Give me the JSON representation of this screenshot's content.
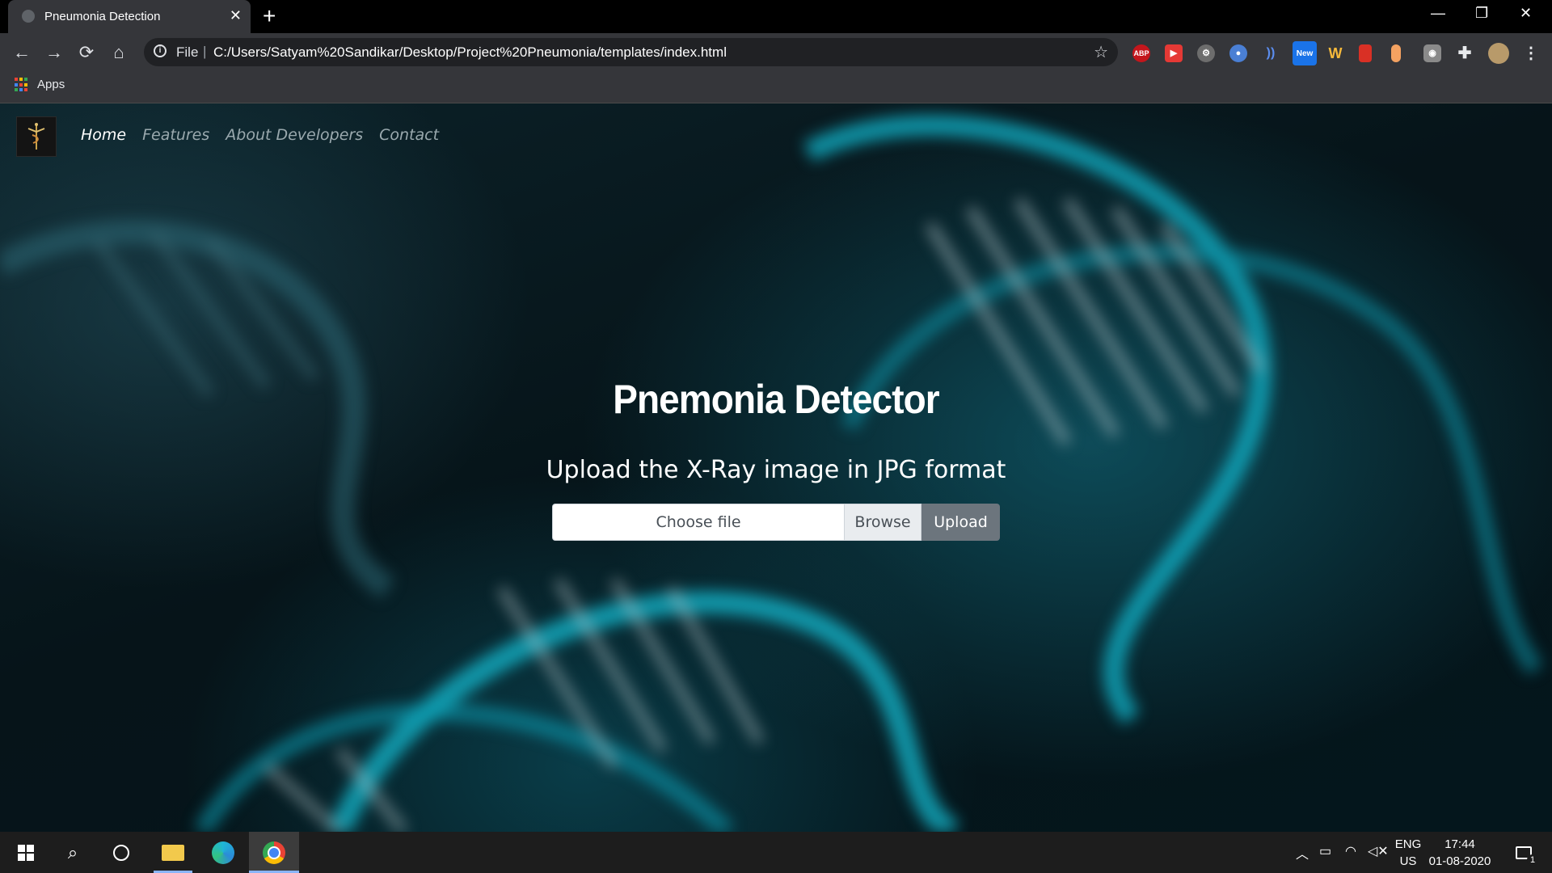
{
  "browser": {
    "tab_title": "Pneumonia Detection",
    "tab_close": "✕",
    "new_tab": "+",
    "scheme_label": "File",
    "url": "C:/Users/Satyam%20Sandikar/Desktop/Project%20Pneumonia/templates/index.html",
    "bookmarks_apps": "Apps",
    "extension_new_badge": "New",
    "extension_abp": "ABP"
  },
  "site": {
    "nav": [
      "Home",
      "Features",
      "About Developers",
      "Contact"
    ],
    "active_nav": "Home",
    "title": "Pnemonia Detector",
    "subtitle": "Upload the X-Ray image in JPG format",
    "file_placeholder": "Choose file",
    "browse_label": "Browse",
    "upload_label": "Upload"
  },
  "taskbar": {
    "language": "ENG",
    "region": "US",
    "time": "17:44",
    "date": "01-08-2020",
    "notification_count": "1"
  },
  "colors": {
    "accent": "#6c757d",
    "background_teal": "#0e6e80",
    "chrome_bar": "#35363a"
  }
}
